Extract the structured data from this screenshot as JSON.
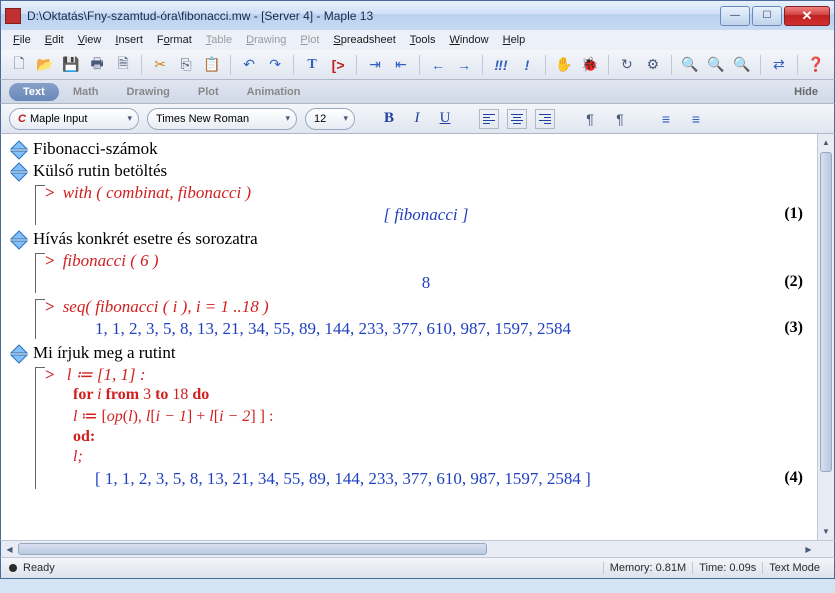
{
  "window": {
    "title": "D:\\Oktatás\\Fny-szamtud-óra\\fibonacci.mw - [Server 4] - Maple 13"
  },
  "menu": {
    "file": "File",
    "edit": "Edit",
    "view": "View",
    "insert": "Insert",
    "format": "Format",
    "table": "Table",
    "drawing": "Drawing",
    "plot": "Plot",
    "spreadsheet": "Spreadsheet",
    "tools": "Tools",
    "window": "Window",
    "help": "Help"
  },
  "tabs": {
    "text": "Text",
    "math": "Math",
    "drawing": "Drawing",
    "plot": "Plot",
    "animation": "Animation",
    "hide": "Hide"
  },
  "context": {
    "style": "Maple Input",
    "font": "Times New Roman",
    "size": "12"
  },
  "doc": {
    "h1": "Fibonacci-számok",
    "h2": "Külső rutin betöltés",
    "in1": "with ( combinat, fibonacci )",
    "out1": "[ fibonacci ]",
    "eq1": "(1)",
    "h3": "Hívás konkrét esetre és sorozatra",
    "in2": "fibonacci ( 6 )",
    "out2": "8",
    "eq2": "(2)",
    "in3": "seq( fibonacci ( i ), i = 1 ..18 )",
    "out3": "1, 1, 2, 3, 5, 8, 13, 21, 34, 55, 89, 144, 233, 377, 610, 987, 1597, 2584",
    "eq3": "(3)",
    "h4": "Mi írjuk meg a rutint",
    "code": {
      "l1a": "l",
      "l1b": " ≔ [1, 1] :",
      "l2a": "for ",
      "l2b": "i",
      "l2c": " from ",
      "l2d": "3",
      "l2e": " to ",
      "l2f": "18",
      "l2g": " do",
      "l3a": " l",
      "l3b": " ≔ [",
      "l3c": "op",
      "l3d": "(",
      "l3e": "l",
      "l3f": "), ",
      "l3g": "l",
      "l3h": "[",
      "l3i": "i − 1",
      "l3j": "] + ",
      "l3k": "l",
      "l3l": "[",
      "l3m": "i − 2",
      "l3n": "] ] :",
      "l4": "od:",
      "l5": "l;"
    },
    "out4": "[ 1, 1, 2, 3, 5, 8, 13, 21, 34, 55, 89, 144, 233, 377, 610, 987, 1597, 2584 ]",
    "eq4": "(4)"
  },
  "status": {
    "ready": "Ready",
    "memory": "Memory: 0.81M",
    "time": "Time: 0.09s",
    "mode": "Text Mode"
  }
}
